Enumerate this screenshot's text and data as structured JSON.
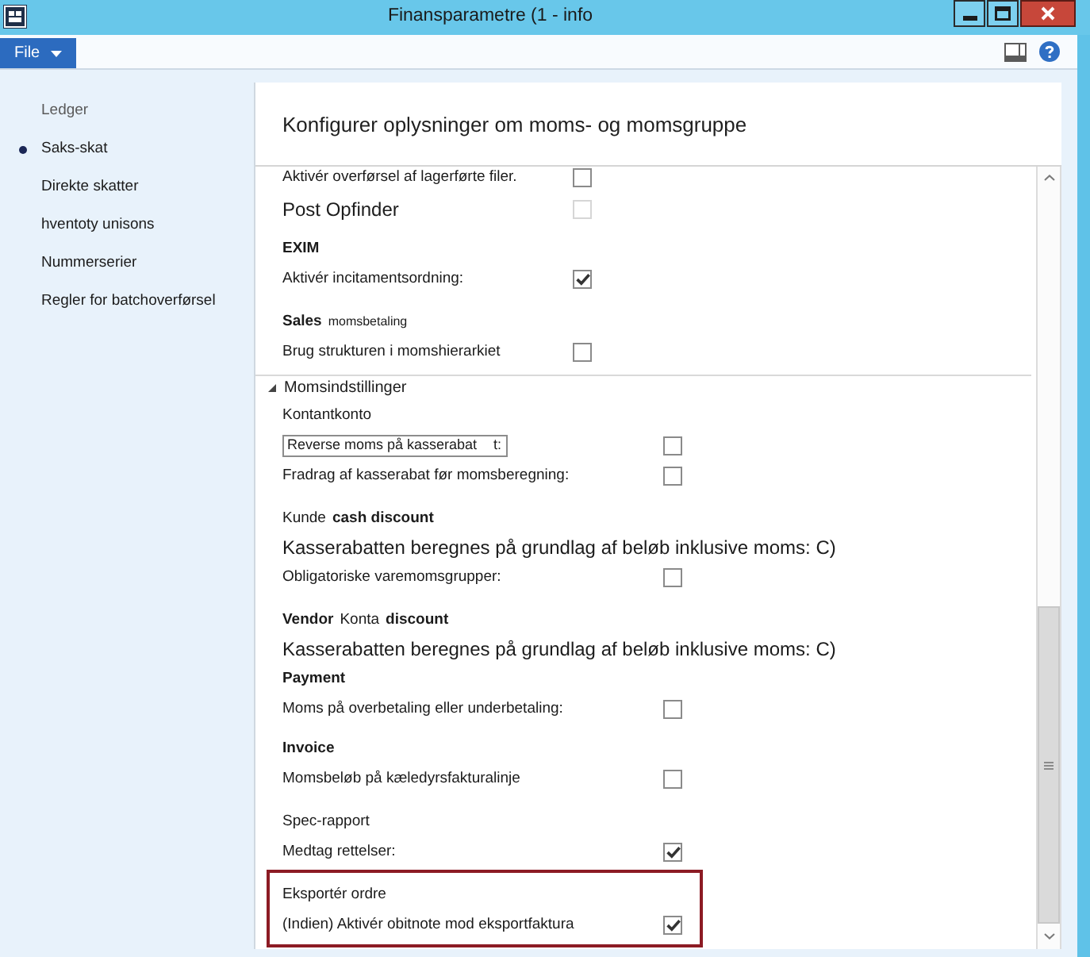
{
  "window": {
    "title": "Finansparametre (1 - info"
  },
  "menu_bar": {
    "file_button": "File"
  },
  "navigation": {
    "header": "Ledger",
    "items": [
      {
        "label": "Saks-skat",
        "selected": true
      },
      {
        "label": "Direkte skatter",
        "selected": false
      },
      {
        "label": "hventoty unisons",
        "selected": false
      },
      {
        "label": "Nummerserier",
        "selected": false
      },
      {
        "label": "Regler for batchoverførsel",
        "selected": false
      }
    ]
  },
  "panel": {
    "title": "Konfigurer oplysninger om moms- og momsgruppe",
    "sections": [
      {
        "kind": "plain",
        "rows": [
          {
            "kind": "checkbox",
            "label": "Aktivér overførsel af lagerførte filer.",
            "checked": false,
            "disabled": false
          },
          {
            "kind": "large_checkbox",
            "label": "Post Opfinder",
            "checked": false,
            "disabled": true
          },
          {
            "kind": "heading",
            "text": "EXIM"
          },
          {
            "kind": "checkbox",
            "label": "Aktivér incitamentsordning:",
            "checked": true,
            "disabled": false
          },
          {
            "kind": "mixed",
            "parts": [
              {
                "text": "Sales",
                "bold": true,
                "small": false
              },
              {
                "text": "momsbetaling",
                "bold": false,
                "small": true
              }
            ]
          },
          {
            "kind": "checkbox",
            "label": "Brug strukturen i momshierarkiet",
            "checked": false,
            "disabled": false
          }
        ]
      },
      {
        "kind": "group",
        "title": "Momsindstillinger",
        "expanded": true,
        "rows": [
          {
            "kind": "label",
            "text": "Kontantkonto"
          },
          {
            "kind": "field",
            "value": "Reverse moms på kasserabat",
            "suffix": "t:",
            "checked": false,
            "disabled": false
          },
          {
            "kind": "checkbox",
            "label": "Fradrag af kasserabat før momsberegning:",
            "checked": false,
            "disabled": false
          },
          {
            "kind": "mixed",
            "parts": [
              {
                "text": "Kunde",
                "bold": false,
                "small": false
              },
              {
                "text": "cash discount",
                "bold": true,
                "small": false
              }
            ]
          },
          {
            "kind": "large_text",
            "text": "Kasserabatten beregnes på grundlag af beløb inklusive moms: C)"
          },
          {
            "kind": "checkbox",
            "label": "Obligatoriske varemomsgrupper:",
            "checked": false,
            "disabled": false
          },
          {
            "kind": "mixed",
            "parts": [
              {
                "text": "Vendor",
                "bold": true,
                "small": false
              },
              {
                "text": "Konta",
                "bold": false,
                "small": false
              },
              {
                "text": "discount",
                "bold": true,
                "small": false
              }
            ]
          },
          {
            "kind": "large_text",
            "text": "Kasserabatten beregnes på grundlag af beløb inklusive moms: C)"
          },
          {
            "kind": "heading",
            "text": "Payment"
          },
          {
            "kind": "checkbox",
            "label": "Moms på overbetaling eller underbetaling:",
            "checked": false,
            "disabled": false
          },
          {
            "kind": "heading",
            "text": "Invoice"
          },
          {
            "kind": "checkbox",
            "label": "Momsbeløb på kæledyrsfakturalinje",
            "checked": false,
            "disabled": false
          },
          {
            "kind": "label",
            "text": "Spec-rapport"
          },
          {
            "kind": "checkbox",
            "label": "Medtag rettelser:",
            "checked": true,
            "disabled": false
          }
        ],
        "highlighted_rows": [
          {
            "kind": "label",
            "text": "Eksportér ordre"
          },
          {
            "kind": "checkbox",
            "label": "(Indien) Aktivér obitnote mod eksportfaktura",
            "checked": true,
            "disabled": false
          }
        ]
      }
    ]
  }
}
